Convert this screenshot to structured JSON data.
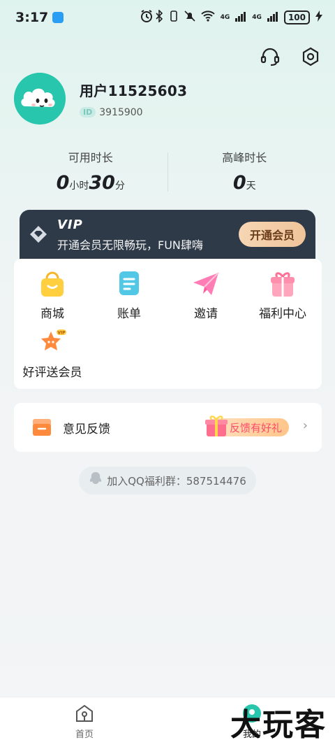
{
  "status_bar": {
    "time": "3:17",
    "network_left": "4G",
    "network_right": "4G",
    "battery": "100"
  },
  "header": {
    "icons": [
      "headset-icon",
      "settings-icon"
    ]
  },
  "profile": {
    "username": "用户11525603",
    "id_badge": "ID",
    "user_id": "3915900"
  },
  "stats": {
    "available": {
      "label": "可用时长",
      "hours": "0",
      "hours_unit": "小时",
      "minutes": "30",
      "minutes_unit": "分"
    },
    "peak": {
      "label": "高峰时长",
      "days": "0",
      "days_unit": "天"
    }
  },
  "vip": {
    "title": "VIP",
    "subtitle": "开通会员无限畅玩，FUN肆嗨",
    "button": "开通会员"
  },
  "menu": {
    "items": [
      {
        "label": "商城",
        "icon": "shopping-bag-icon"
      },
      {
        "label": "账单",
        "icon": "bill-icon"
      },
      {
        "label": "邀请",
        "icon": "paper-plane-icon"
      },
      {
        "label": "福利中心",
        "icon": "gift-icon"
      },
      {
        "label": "好评送会员",
        "icon": "vip-star-icon"
      }
    ]
  },
  "feedback": {
    "label": "意见反馈",
    "badge": "反馈有好礼"
  },
  "qq_group": {
    "text": "加入QQ福利群：587514476"
  },
  "bottom_nav": {
    "home": "首页",
    "mine": "我的"
  },
  "watermark": "大玩客",
  "colors": {
    "accent_teal": "#27c6ad",
    "vip_dark": "#2e3a48",
    "vip_button": "#efc49a",
    "feedback_badge_text": "#ff4b6b"
  }
}
